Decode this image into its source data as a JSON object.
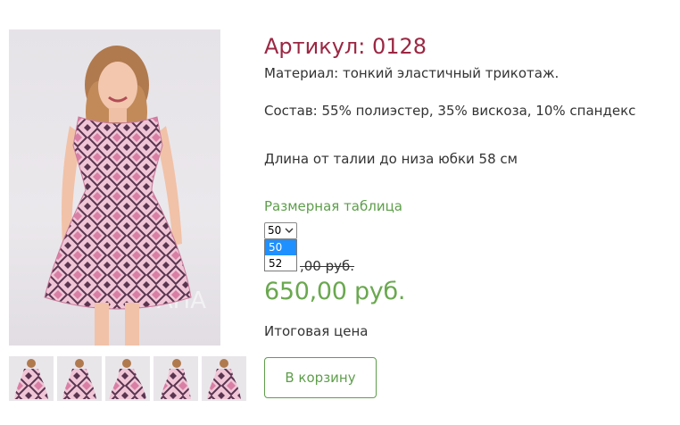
{
  "product": {
    "sku": "Артикул: 0128",
    "material": "Материал: тонкий эластичный трикотаж.",
    "composition": "Состав: 55% полиэстер, 35% вискоза, 10% спандекс",
    "length": "Длина от талии до низа юбки 58 см",
    "size_table_link": "Размерная таблица",
    "size_select": {
      "selected": "50",
      "options": [
        "50",
        "52"
      ]
    },
    "old_price": ",00 руб.",
    "price": "650,00 руб.",
    "total_label": "Итоговая цена",
    "add_to_cart": "В корзину"
  },
  "gallery": {
    "thumbnail_count": 5
  },
  "colors": {
    "sku": "#9b2743",
    "accent_green": "#5e9e4b",
    "price_green": "#6aa84f",
    "selected_option": "#1e90ff",
    "dress_pink": "#e8a0c0"
  }
}
